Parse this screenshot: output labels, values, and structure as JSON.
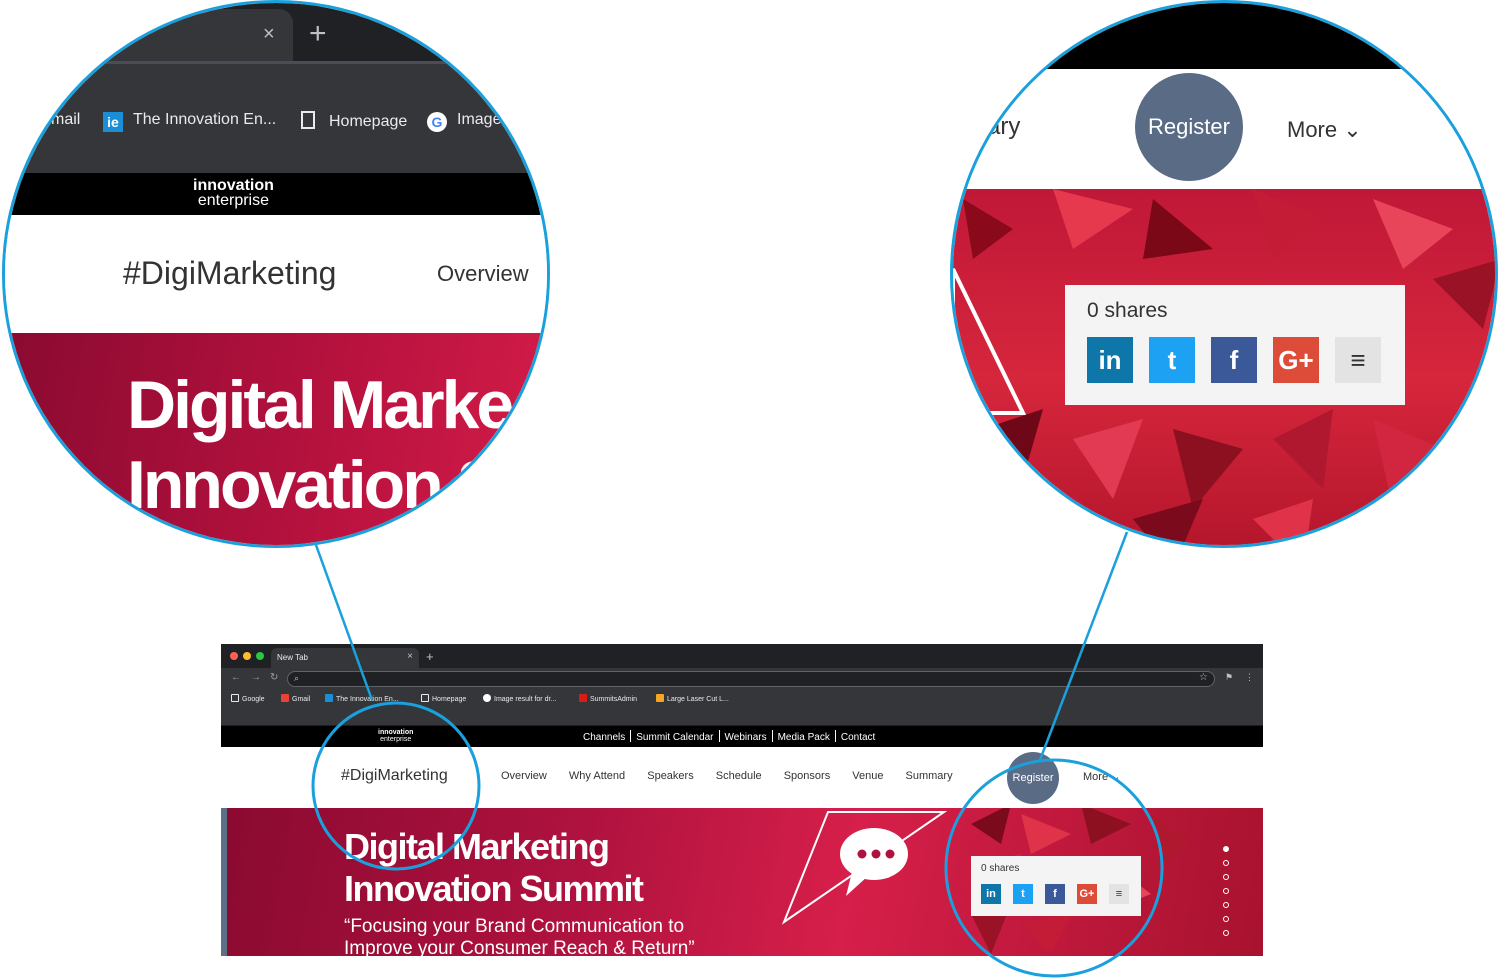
{
  "browser": {
    "tab_title": "New Tab",
    "tab_close": "×",
    "new_tab": "+",
    "bookmarks": [
      {
        "label": "Google"
      },
      {
        "label": "Gmail"
      },
      {
        "label": "The Innovation En..."
      },
      {
        "label": "Homepage"
      },
      {
        "label": "Image result for dr..."
      },
      {
        "label": "SummitsAdmin"
      },
      {
        "label": "Large Laser Cut L..."
      }
    ]
  },
  "site": {
    "logo_line1": "innovation",
    "logo_line2": "enterprise",
    "top_links": [
      "Channels",
      "Summit Calendar",
      "Webinars",
      "Media Pack",
      "Contact"
    ],
    "brand": "#DigiMarketing",
    "nav": [
      "Overview",
      "Why Attend",
      "Speakers",
      "Schedule",
      "Sponsors",
      "Venue",
      "Summary"
    ],
    "register": "Register",
    "more": "More",
    "hero_title_1": "Digital Marketing",
    "hero_title_2": "Innovation Summit",
    "hero_sub_1": "“Focusing your Brand Communication to",
    "hero_sub_2": "Improve your Consumer Reach & Return”",
    "shares": "0 shares",
    "share_icons": [
      {
        "name": "linkedin-icon",
        "glyph": "in",
        "color": "#0e76a8"
      },
      {
        "name": "twitter-icon",
        "glyph": "t",
        "color": "#1da1f2"
      },
      {
        "name": "facebook-icon",
        "glyph": "f",
        "color": "#3b5998"
      },
      {
        "name": "google-plus-icon",
        "glyph": "G+",
        "color": "#dd4b39"
      },
      {
        "name": "buffer-icon",
        "glyph": "≡",
        "color": "#e3e3e3"
      }
    ]
  },
  "zoom_left": {
    "bm_gmail": "mail",
    "bm_ie_icon": "ie",
    "bm_ie": "The Innovation En...",
    "bm_home": "Homepage",
    "bm_image": "Image",
    "overview": "Overview",
    "title_1": "Digital Marke",
    "title_2": "Innovation S"
  },
  "zoom_right": {
    "summary_fragment": "ary"
  }
}
